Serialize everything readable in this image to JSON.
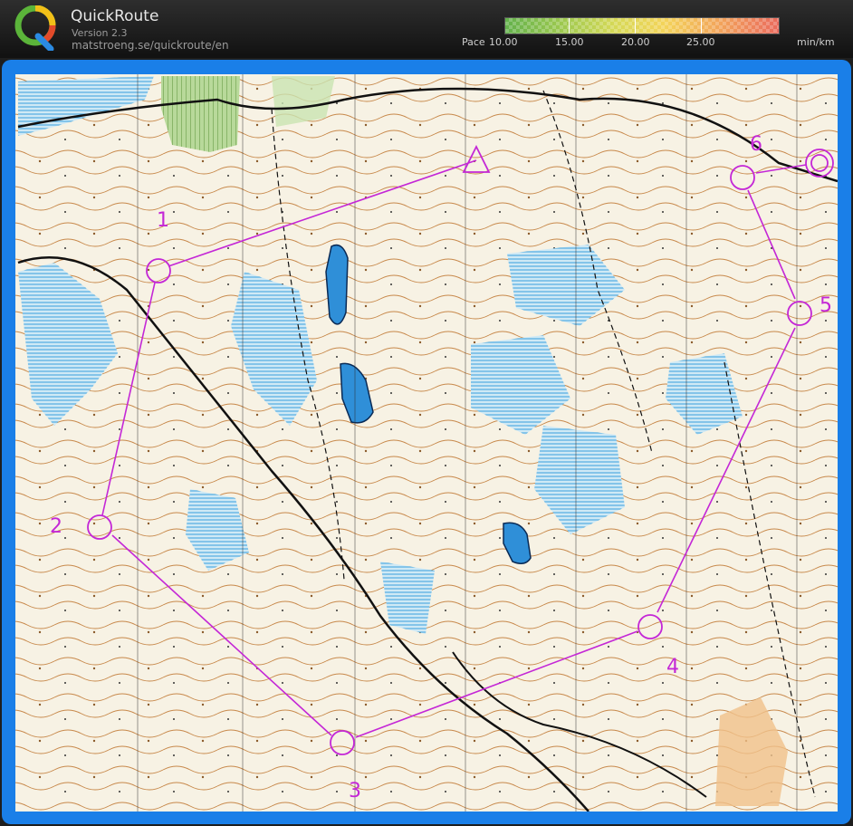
{
  "app": {
    "title": "QuickRoute",
    "version": "Version 2.3",
    "url": "matstroeng.se/quickroute/en"
  },
  "pace_scale": {
    "label": "Pace",
    "ticks": [
      "10.00",
      "15.00",
      "20.00",
      "25.00"
    ],
    "unit": "min/km"
  },
  "course": {
    "color": "#c427d6",
    "controls": [
      {
        "label": "1"
      },
      {
        "label": "2"
      },
      {
        "label": "3"
      },
      {
        "label": "4"
      },
      {
        "label": "5"
      },
      {
        "label": "6"
      }
    ]
  }
}
